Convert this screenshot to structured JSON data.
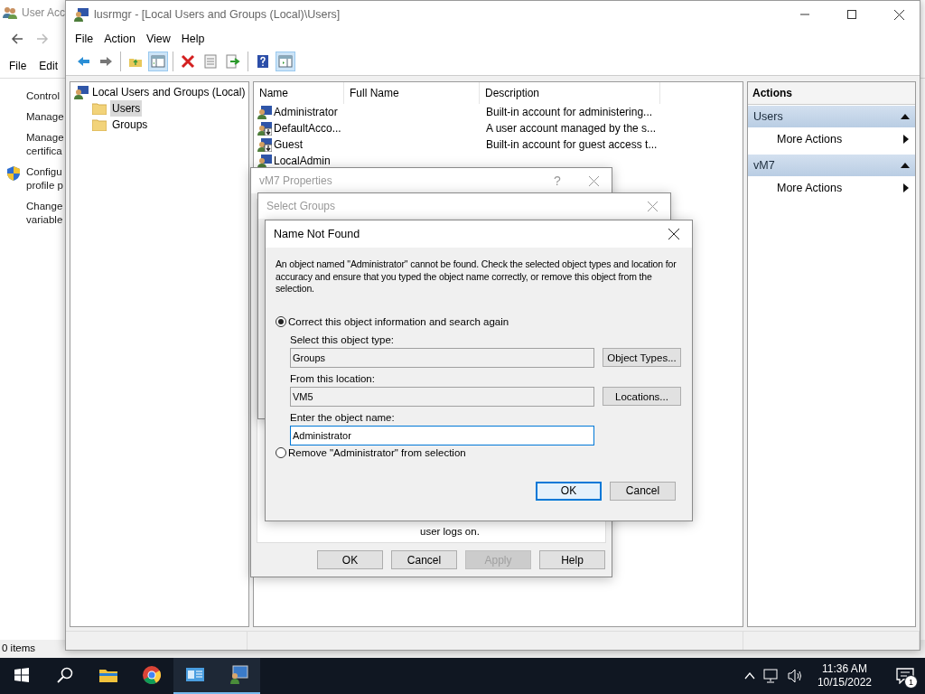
{
  "background_window": {
    "title": "User Acc",
    "menu": [
      "File",
      "Edit"
    ],
    "links": [
      {
        "kind": "plain",
        "lines": [
          "Control"
        ]
      },
      {
        "kind": "plain",
        "lines": [
          "Manage"
        ]
      },
      {
        "kind": "plain",
        "lines": [
          "Manage",
          "certifica"
        ]
      },
      {
        "kind": "shield",
        "lines": [
          "Configu",
          "profile p"
        ]
      },
      {
        "kind": "plain",
        "lines": [
          "Change",
          "variable"
        ]
      }
    ],
    "status": "0 items"
  },
  "window": {
    "title": "lusrmgr - [Local Users and Groups (Local)\\Users]",
    "menu": [
      "File",
      "Action",
      "View",
      "Help"
    ],
    "toolbar_groups": [
      {
        "buttons": [
          {
            "kind": "back",
            "on": false
          },
          {
            "kind": "forward",
            "on": false
          }
        ]
      },
      {
        "buttons": [
          {
            "kind": "up-folder",
            "on": false
          },
          {
            "kind": "console-tree",
            "on": true
          }
        ]
      },
      {
        "buttons": [
          {
            "kind": "delete",
            "on": false
          },
          {
            "kind": "properties",
            "on": false
          },
          {
            "kind": "export",
            "on": false
          }
        ]
      },
      {
        "buttons": [
          {
            "kind": "help",
            "on": false
          },
          {
            "kind": "action-pane",
            "on": true
          }
        ]
      }
    ],
    "tree": {
      "label": "Local Users and Groups (Local)",
      "children": [
        {
          "label": "Users",
          "selected": true
        },
        {
          "label": "Groups",
          "selected": false
        }
      ]
    },
    "table": {
      "columns": [
        "Name",
        "Full Name",
        "Description"
      ],
      "rows": [
        {
          "name": "Administrator",
          "description": "Built-in account for administering...",
          "disabled": false
        },
        {
          "name": "DefaultAcco...",
          "description": "A user account managed by the s...",
          "disabled": true
        },
        {
          "name": "Guest",
          "description": "Built-in account for guest access t...",
          "disabled": true
        },
        {
          "name": "LocalAdmin",
          "disabled": false
        }
      ]
    },
    "actions": {
      "title": "Actions",
      "sections": [
        {
          "title": "Users",
          "expanded": true,
          "items": [
            "More Actions"
          ]
        },
        {
          "title": "vM7",
          "expanded": true,
          "items": [
            "More Actions"
          ]
        }
      ]
    }
  },
  "properties_dialog": {
    "title": "vM7 Properties",
    "help": "?",
    "note": "user logs on.",
    "buttons": [
      {
        "label": "OK",
        "disabled": false
      },
      {
        "label": "Cancel",
        "disabled": false
      },
      {
        "label": "Apply",
        "disabled": true
      },
      {
        "label": "Help",
        "disabled": false
      }
    ]
  },
  "select_groups_dialog": {
    "title": "Select Groups"
  },
  "name_not_found_dialog": {
    "title": "Name Not Found",
    "message": "An object named \"Administrator\" cannot be found. Check the selected object types and location for accuracy and ensure that you typed the object name correctly, or remove this object from the selection.",
    "options": [
      {
        "label": "Correct this object information and search again",
        "selected": true
      },
      {
        "label": "Remove \"Administrator\" from selection",
        "selected": false
      }
    ],
    "fields": [
      {
        "label": "Select this object type:",
        "value": "Groups",
        "readonly": true,
        "button": "Object Types..."
      },
      {
        "label": "From this location:",
        "value": "VM5",
        "readonly": true,
        "button": "Locations..."
      },
      {
        "label": "Enter the object name:",
        "value": "Administrator",
        "readonly": false
      }
    ],
    "buttons": [
      {
        "label": "OK",
        "default": true
      },
      {
        "label": "Cancel",
        "default": false
      }
    ]
  },
  "taskbar": {
    "apps": [
      {
        "kind": "explorer",
        "running": false
      },
      {
        "kind": "chrome",
        "running": false
      },
      {
        "kind": "control-panel",
        "running": true
      },
      {
        "kind": "users",
        "running": true
      }
    ],
    "time": "11:36 AM",
    "date": "10/15/2022",
    "notifications": "1"
  }
}
